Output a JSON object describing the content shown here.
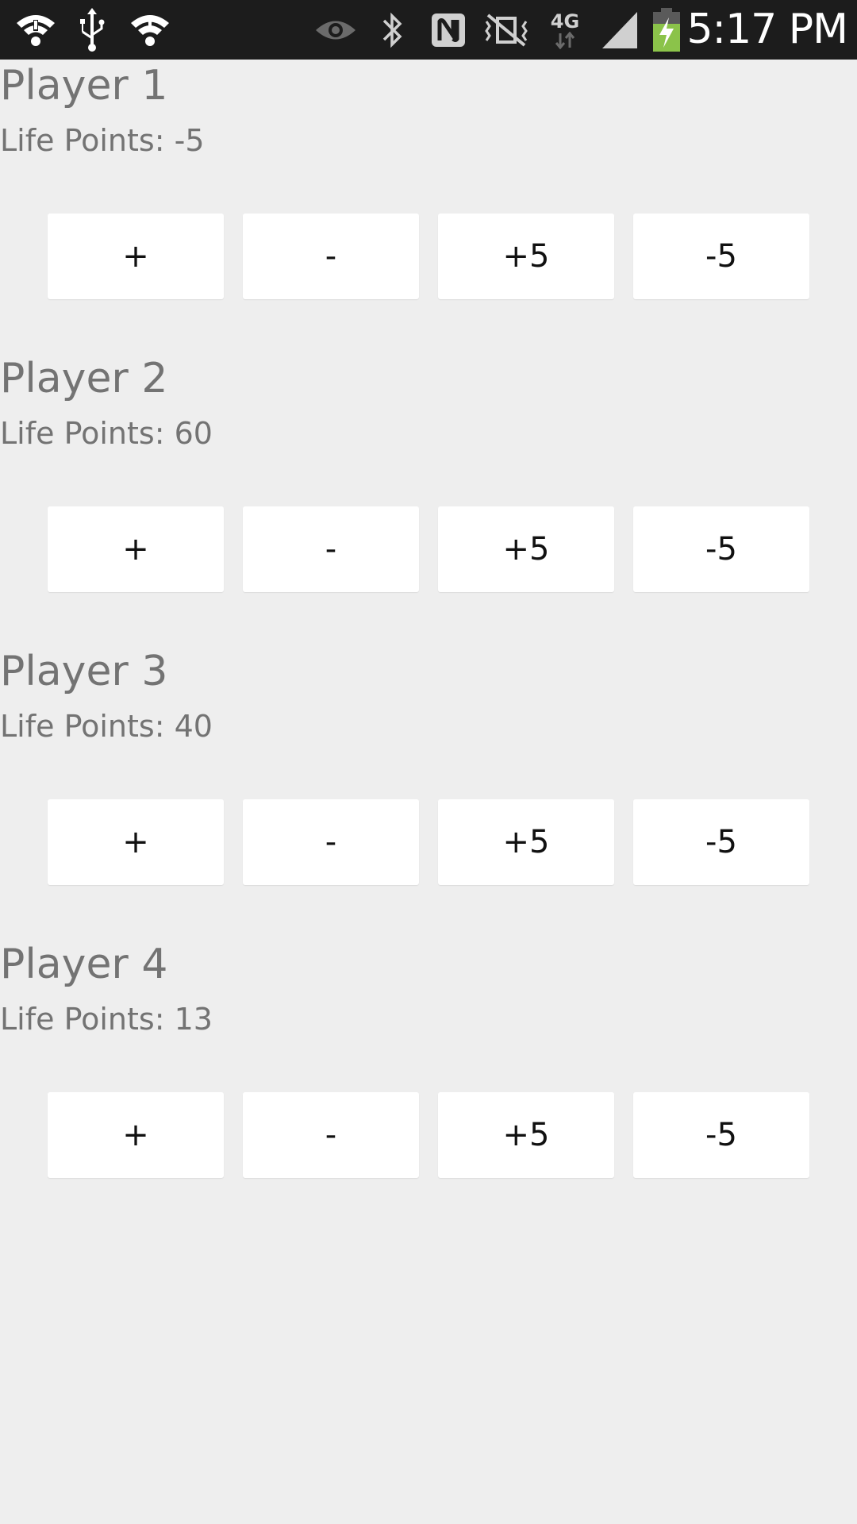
{
  "status_bar": {
    "time": "5:17 PM",
    "network_label": "4G",
    "battery_color": "#8bc34a",
    "icons": [
      "wifi-alert-icon",
      "usb-icon",
      "wifi-alert-icon",
      "eye-icon",
      "bluetooth-icon",
      "nfc-icon",
      "mute-icon",
      "network-4g-icon",
      "signal-icon",
      "battery-charging-icon"
    ]
  },
  "players": [
    {
      "name": "Player 1",
      "life_label": "Life Points: ",
      "life_value": "-5",
      "buttons": {
        "plus": "+",
        "minus": "-",
        "plus5": "+5",
        "minus5": "-5"
      }
    },
    {
      "name": "Player 2",
      "life_label": "Life Points: ",
      "life_value": "60",
      "buttons": {
        "plus": "+",
        "minus": "-",
        "plus5": "+5",
        "minus5": "-5"
      }
    },
    {
      "name": "Player 3",
      "life_label": "Life Points: ",
      "life_value": "40",
      "buttons": {
        "plus": "+",
        "minus": "-",
        "plus5": "+5",
        "minus5": "-5"
      }
    },
    {
      "name": "Player 4",
      "life_label": "Life Points: ",
      "life_value": "13",
      "buttons": {
        "plus": "+",
        "minus": "-",
        "plus5": "+5",
        "minus5": "-5"
      }
    }
  ]
}
